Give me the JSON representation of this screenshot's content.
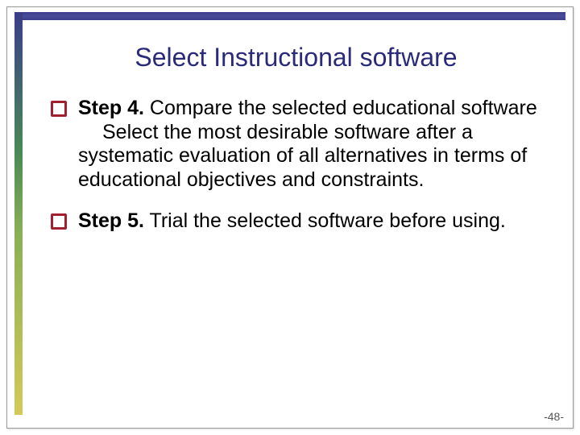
{
  "title": "Select Instructional software",
  "bullets": [
    {
      "step_label": "Step 4.",
      "heading_rest": " Compare the selected educational software",
      "body": "Select the most desirable software after a systematic evaluation of all alternatives in terms of educational objectives and constraints."
    },
    {
      "step_label": "Step 5.",
      "heading_rest": " Trial the selected software before using.",
      "body": ""
    }
  ],
  "page_number": "-48-"
}
